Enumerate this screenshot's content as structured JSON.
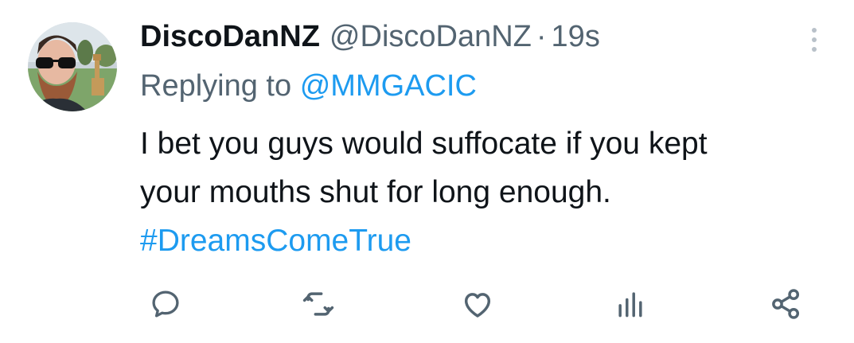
{
  "tweet": {
    "author": {
      "display_name": "DiscoDanNZ",
      "handle": "@DiscoDanNZ",
      "avatar_icon": "profile-photo"
    },
    "separator": "·",
    "timestamp": "19s",
    "reply": {
      "prefix": "Replying to",
      "target": "@MMGACIC"
    },
    "text_lines": [
      "I bet you guys would suffocate if you kept",
      "your mouths shut for long enough."
    ],
    "hashtag": "#DreamsComeTrue",
    "actions": [
      {
        "icon": "reply-icon"
      },
      {
        "icon": "retweet-icon"
      },
      {
        "icon": "like-icon"
      },
      {
        "icon": "views-icon"
      },
      {
        "icon": "share-icon"
      }
    ]
  },
  "colors": {
    "primary_text": "#0f1419",
    "secondary_text": "#536471",
    "accent": "#1d9bf0",
    "icon": "#536471",
    "background": "#ffffff"
  }
}
